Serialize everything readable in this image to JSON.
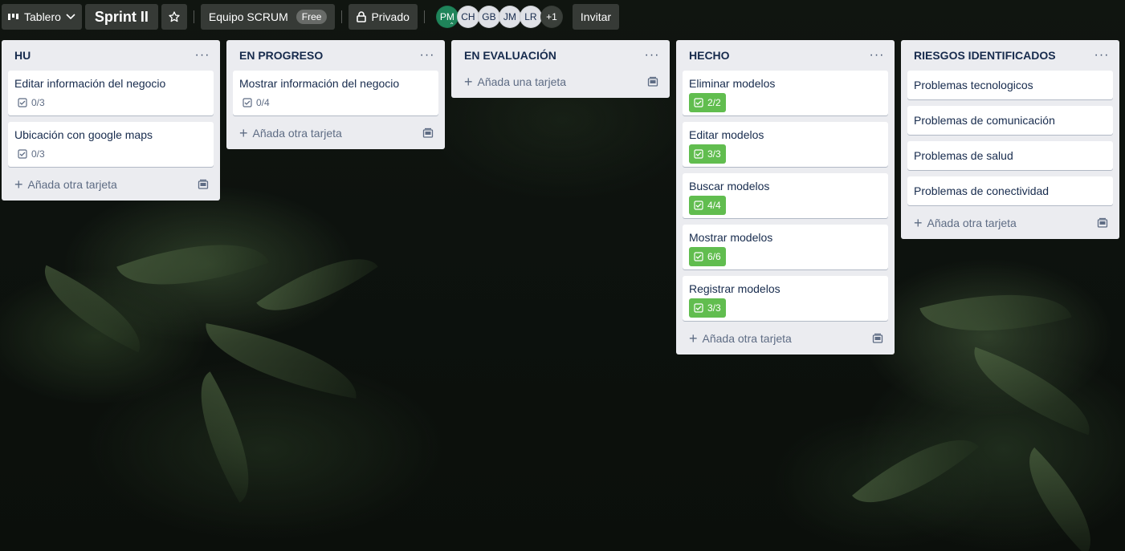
{
  "header": {
    "view_label": "Tablero",
    "board_title": "Sprint II",
    "workspace_name": "Equipo SCRUM",
    "workspace_badge": "Free",
    "visibility_label": "Privado",
    "members": [
      "PM",
      "CH",
      "GB",
      "JM",
      "LR"
    ],
    "members_more": "+1",
    "invite_label": "Invitar"
  },
  "lists": [
    {
      "title": "HU",
      "cards": [
        {
          "title": "Editar información del negocio",
          "checklist": "0/3",
          "done": false
        },
        {
          "title": "Ubicación con google maps",
          "checklist": "0/3",
          "done": false
        }
      ],
      "add_label": "Añada otra tarjeta"
    },
    {
      "title": "EN PROGRESO",
      "cards": [
        {
          "title": "Mostrar información del negocio",
          "checklist": "0/4",
          "done": false
        }
      ],
      "add_label": "Añada otra tarjeta"
    },
    {
      "title": "EN EVALUACIÓN",
      "cards": [],
      "add_label": "Añada una tarjeta"
    },
    {
      "title": "HECHO",
      "cards": [
        {
          "title": "Eliminar modelos",
          "checklist": "2/2",
          "done": true
        },
        {
          "title": "Editar modelos",
          "checklist": "3/3",
          "done": true
        },
        {
          "title": "Buscar modelos",
          "checklist": "4/4",
          "done": true
        },
        {
          "title": "Mostrar modelos",
          "checklist": "6/6",
          "done": true
        },
        {
          "title": "Registrar modelos",
          "checklist": "3/3",
          "done": true
        }
      ],
      "add_label": "Añada otra tarjeta"
    },
    {
      "title": "RIESGOS IDENTIFICADOS",
      "cards": [
        {
          "title": "Problemas tecnologicos"
        },
        {
          "title": "Problemas de comunicación"
        },
        {
          "title": "Problemas de salud"
        },
        {
          "title": "Problemas de conectividad"
        }
      ],
      "add_label": "Añada otra tarjeta"
    }
  ],
  "colors": {
    "checklist_done": "#61bd4f",
    "list_bg": "#ebecf0",
    "admin_avatar": "#1f845a"
  },
  "icons": {
    "menu": "ellipsis-icon",
    "checklist": "checkbox-icon",
    "add": "plus-icon",
    "template": "card-template-icon"
  }
}
